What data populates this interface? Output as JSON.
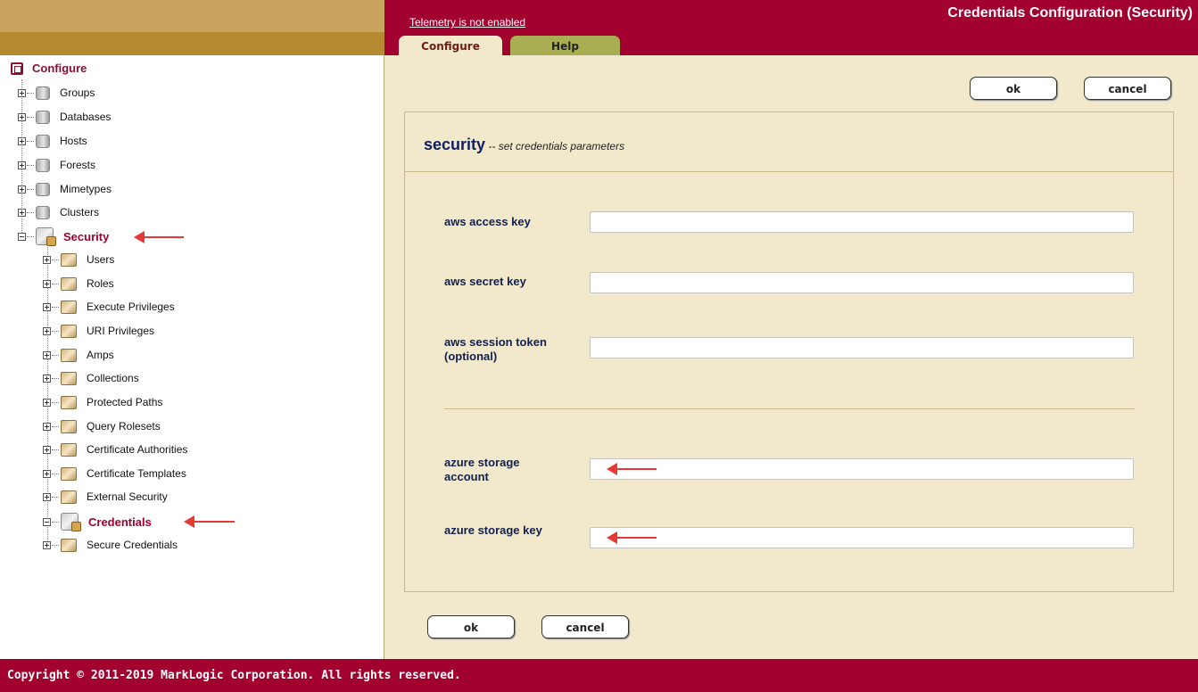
{
  "header": {
    "telemetry_link": "Telemetry is not enabled",
    "title": "Credentials Configuration (Security)",
    "tabs": [
      {
        "label": "Configure"
      },
      {
        "label": "Help"
      }
    ]
  },
  "sidebar": {
    "root": "Configure",
    "top_items": [
      {
        "label": "Groups"
      },
      {
        "label": "Databases"
      },
      {
        "label": "Hosts"
      },
      {
        "label": "Forests"
      },
      {
        "label": "Mimetypes"
      },
      {
        "label": "Clusters"
      }
    ],
    "security": {
      "label": "Security",
      "children": [
        {
          "label": "Users"
        },
        {
          "label": "Roles"
        },
        {
          "label": "Execute Privileges"
        },
        {
          "label": "URI Privileges"
        },
        {
          "label": "Amps"
        },
        {
          "label": "Collections"
        },
        {
          "label": "Protected Paths"
        },
        {
          "label": "Query Rolesets"
        },
        {
          "label": "Certificate Authorities"
        },
        {
          "label": "Certificate Templates"
        },
        {
          "label": "External Security"
        },
        {
          "label": "Credentials"
        },
        {
          "label": "Secure Credentials"
        }
      ]
    }
  },
  "main": {
    "ok_label": "ok",
    "cancel_label": "cancel",
    "section_title": "security",
    "section_desc": " -- set credentials parameters",
    "fields": [
      {
        "label": "aws access key",
        "value": ""
      },
      {
        "label": "aws secret key",
        "value": ""
      },
      {
        "label": "aws session token (optional)",
        "value": ""
      },
      {
        "label": "azure storage account",
        "value": ""
      },
      {
        "label": "azure storage key",
        "value": ""
      }
    ]
  },
  "footer": {
    "copyright": "Copyright © 2011-2019 MarkLogic Corporation. All rights reserved."
  },
  "colors": {
    "brand": "#a2002f",
    "panel_bg": "#f2e8cb",
    "annotation_arrow": "#e53935"
  }
}
